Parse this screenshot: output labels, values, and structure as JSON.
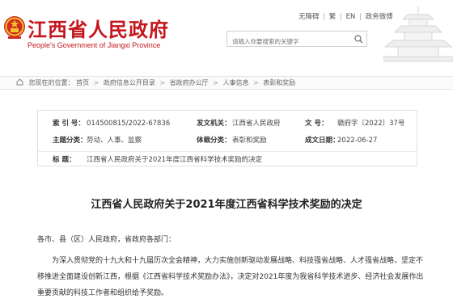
{
  "header": {
    "title_cn": "江西省人民政府",
    "title_en": "People's Government of Jiangxi Province",
    "top_links": [
      "无障碍",
      "繁",
      "EN",
      "政务微博"
    ],
    "search": {
      "placeholder": "请输入你要搜索的关键字"
    },
    "icons": {
      "emblem": "national-emblem-icon",
      "search": "search-icon",
      "pavilion": "tengwang-pavilion-icon"
    }
  },
  "breadcrumb": {
    "label": "您现在的位置：",
    "items": [
      "首页",
      "政府信息公开目录",
      "省政府办公厅",
      "人事信息",
      "表彰和奖励"
    ]
  },
  "info": {
    "index_label": "索 引 号：",
    "index_value": "014500815/2022-67836",
    "issuer_label": "发文机关：",
    "issuer_value": "江西省人民政府",
    "doc_no_label": "文   号：",
    "doc_no_value": "赣府字〔2022〕37号",
    "category_label": "主题分类：",
    "category_value": "劳动、人事、监察",
    "genre_label": "体裁分类：",
    "genre_value": "表彰和奖励",
    "date_label": "成文日期：",
    "date_value": "2022-06-27",
    "subject_label": "标   题：",
    "subject_value": "江西省人民政府关于2021年度江西省科学技术奖励的决定"
  },
  "article": {
    "title": "江西省人民政府关于2021年度江西省科学技术奖励的决定",
    "addressee": "各市、县（区）人民政府，省政府各部门：",
    "paragraph": "为深入贯彻党的十九大和十九届历次全会精神，大力实施创新驱动发展战略、科技强省战略、人才强省战略，坚定不移推进全面建设创新江西，根据《江西省科学技术奖励办法》，决定对2021年度为我省科学技术进步、经济社会发展作出重要贡献的科技工作者和组织给予奖励。"
  },
  "colors": {
    "brand_red": "#c4161c"
  }
}
